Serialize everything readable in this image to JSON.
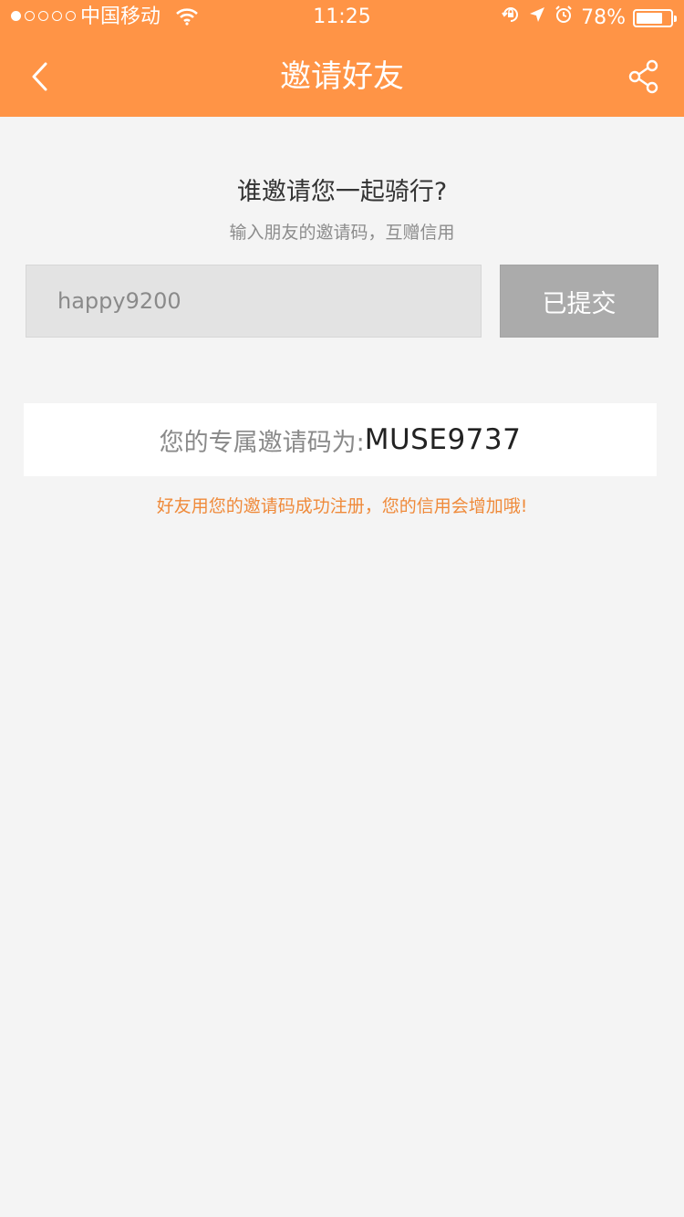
{
  "status_bar": {
    "carrier": "中国移动",
    "time": "11:25",
    "battery_percent": "78%",
    "battery_level": 0.78
  },
  "nav": {
    "title": "邀请好友"
  },
  "invite": {
    "heading": "谁邀请您一起骑行?",
    "subheading": "输入朋友的邀请码，互赠信用",
    "input_value": "happy9200",
    "submit_label": "已提交"
  },
  "my_code": {
    "label": "您的专属邀请码为:",
    "value": "MUSE9737"
  },
  "note": "好友用您的邀请码成功注册，您的信用会增加哦!",
  "colors": {
    "accent": "#ff9446",
    "note_text": "#ef8a3a",
    "background": "#f4f4f4"
  },
  "icons": {
    "back": "chevron-left-icon",
    "share": "share-icon",
    "wifi": "wifi-icon",
    "rotation_lock": "rotation-lock-icon",
    "location": "location-arrow-icon",
    "alarm": "alarm-icon",
    "battery": "battery-icon"
  }
}
